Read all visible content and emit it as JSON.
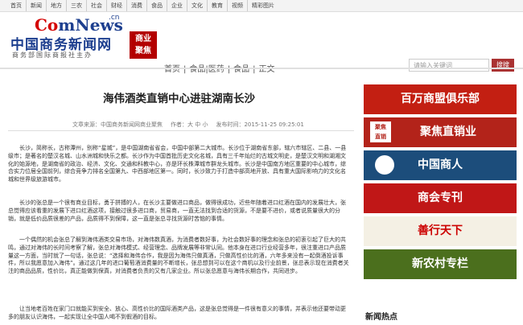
{
  "topnav": [
    "首页",
    "新闻",
    "地方",
    "三农",
    "社会",
    "财经",
    "消费",
    "食品",
    "企业",
    "文化",
    "教育",
    "视频",
    "精彩图片"
  ],
  "logo": {
    "en_c": "Co",
    "en_rest": "mNews",
    "cn_suffix": ".cn",
    "name": "中国商务新闻网",
    "tagline": "商务部国际商报社主办",
    "badge_line1": "商业",
    "badge_line2": "聚焦"
  },
  "breadcrumb": [
    "首页",
    "|",
    "食品|医药",
    "|",
    "食品",
    "|",
    "正文"
  ],
  "search": {
    "placeholder": "请输入关键词",
    "button": "搜搜"
  },
  "article": {
    "title": "海伟酒类直销中心进驻湖南长沙",
    "source": "文章来源：中国商务新闻网商业聚焦",
    "author": "作者：大 中 小",
    "time": "发布时间：2015-11-25 09:25:01",
    "paragraphs": [
      "长沙，简称长，古称潭州，别称“星城”，是中国湖南省省会，中国中部第二大城市。长沙位于湖南省东部，辖六市辖区、二县、一县级市；是著名的楚汉名城、山水洲城和快乐之都。长沙作为中国首批历史文化名城，具有三千年灿烂的古城文明史，是楚汉文明和湖湘文化的始源地，是湖南省的政治、经济、文化、交通和科教中心，亦是环长株潭城市群龙头城市。长沙是中国南方地区重要的中心城市，综合实力位居全国前列，综合竞争力排名全国第九、中西部地区第一。同时，长沙致力于打造中部高地开放、具有重大国际影响力的文化名城和世界级旅游城市。",
      "长沙的张总是一个很有商业目标，勇于拼搏的人，在长沙主要做进口商品，做得很成功，近些年随着进口红酒在国内的发展壮大，张总觉得应该看重的发展下进口红酒这项，接触过很多进口商，贸易商，一直无法找到合适的货源，不是要不进价，或者说质量很大的分销，就是低价品质很差的产品，品质得不到保障，这一直是张总寻找货源时苦恼的事情。",
      "一个偶然的机会张总了解到海伟酒类交易市场，对海伟数真酒，为消费者数好事，为社会数好事的理念和张总的初衷引起了巨大的共鸣，通过对海伟的长时间考察了解，张总对海伟模式、经营理念、品牌发展等非常认同。他本身在进口行业经营多年，很注重进口产品质量这一方面，当时就了一句话，张总说：“选择和海伟合作，我是因为海伟只做真酒，只做高性价比的酒，六年多来没有一起倒酒投诉事件，所以我愿意加入海伟”。通过这几年的进口葡萄酒消费量的不断增长，张总想到可以在这个商机以及行业前景，张总表示现在消费者关注的商品品质，性价比，真正能做到保真，对消费者负责的又有几家企业。所以张总愿意与海伟长期合作，共同进步。",
      "让当地老百姓在家门口就能买到安全、放心、高性价比的国际酒类产品，这是张总觉得是一件很有意义的事情，并表示他还要带动更多的朋友认识海伟，一起实现让全中国人喝不到假酒的目标。"
    ]
  },
  "sidebar": {
    "ads": [
      "百万商盟俱乐部",
      "聚焦直销业",
      "中国商人",
      "商会专刊",
      "善行天下",
      "新农村专栏"
    ],
    "ad2_icon_text_1": "聚焦",
    "ad2_icon_text_2": "直销",
    "hot_title": "新闻热点"
  },
  "colors": {
    "brand_blue": "#1d3f8f",
    "brand_red": "#b30000"
  }
}
